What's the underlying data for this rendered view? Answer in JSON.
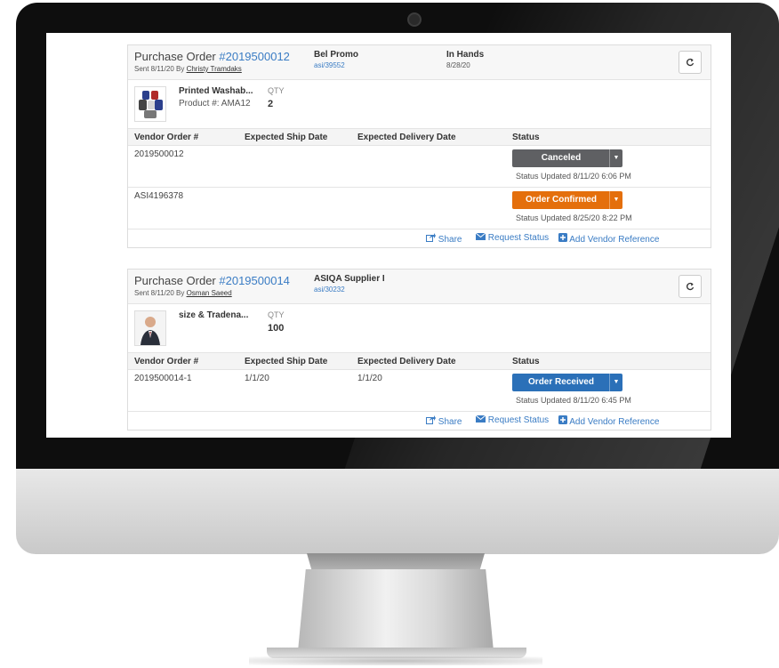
{
  "colors": {
    "link": "#3a7cc4",
    "canceled": "#5f6063",
    "confirmed": "#e46f0c",
    "received": "#2b70b8"
  },
  "orders": [
    {
      "title_prefix": "Purchase Order ",
      "number": "#2019500012",
      "sent_prefix": "Sent 8/11/20 By ",
      "sent_by": "Christy Tramdaks",
      "vendor": "Bel Promo",
      "vendor_id": "asi/39552",
      "in_hands_label": "In Hands",
      "in_hands_date": "8/28/20",
      "product": {
        "name": "Printed Washab...",
        "number": "Product #: AMA12",
        "qty_label": "QTY",
        "qty": "2"
      },
      "headers": [
        "Vendor Order #",
        "Expected Ship Date",
        "Expected Delivery Date",
        "Status"
      ],
      "rows": [
        {
          "vendor_order": "2019500012",
          "ship": "",
          "delivery": "",
          "status": "Canceled",
          "updated": "Status Updated 8/11/20 6:06 PM"
        },
        {
          "vendor_order": "ASI4196378",
          "ship": "",
          "delivery": "",
          "status": "Order Confirmed",
          "updated": "Status Updated 8/25/20 8:22 PM"
        }
      ],
      "links": {
        "share": "Share",
        "request": "Request Status",
        "add_ref": "Add Vendor Reference"
      }
    },
    {
      "title_prefix": "Purchase Order ",
      "number": "#2019500014",
      "sent_prefix": "Sent 8/11/20 By ",
      "sent_by": "Osman Saeed",
      "vendor": "ASIQA Supplier I",
      "vendor_id": "asi/30232",
      "product": {
        "name": "size & Tradena...",
        "qty_label": "QTY",
        "qty": "100"
      },
      "headers": [
        "Vendor Order #",
        "Expected Ship Date",
        "Expected Delivery Date",
        "Status"
      ],
      "rows": [
        {
          "vendor_order": "2019500014-1",
          "ship": "1/1/20",
          "delivery": "1/1/20",
          "status": "Order Received",
          "updated": "Status Updated 8/11/20 6:45 PM"
        }
      ],
      "links": {
        "share": "Share",
        "request": "Request Status",
        "add_ref": "Add Vendor Reference"
      }
    }
  ],
  "icons": {
    "refresh": "refresh-icon",
    "share": "share-icon",
    "envelope": "envelope-icon",
    "plus": "plus-square-icon",
    "caret": "caret-down-icon",
    "camera": "webcam-icon"
  }
}
